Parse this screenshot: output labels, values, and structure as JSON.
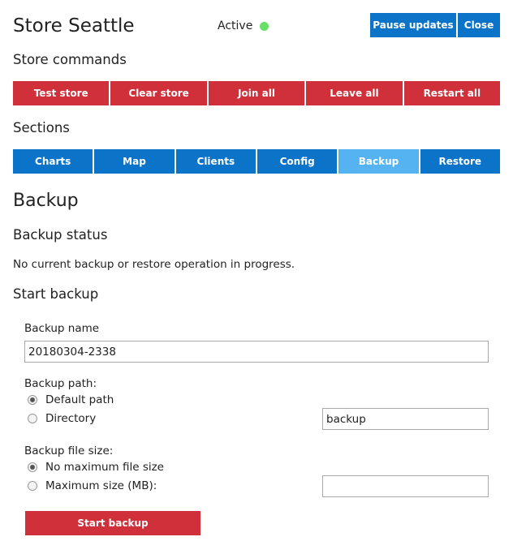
{
  "colors": {
    "blue": "#0b74c8",
    "blue_active": "#56b3f2",
    "red": "#cf303a",
    "status_green": "#66e066"
  },
  "header": {
    "title": "Store Seattle",
    "status": "Active",
    "pause_label": "Pause updates",
    "close_label": "Close"
  },
  "store_commands": {
    "heading": "Store commands",
    "buttons": [
      "Test store",
      "Clear store",
      "Join all",
      "Leave all",
      "Restart all"
    ]
  },
  "sections": {
    "heading": "Sections",
    "tabs": [
      "Charts",
      "Map",
      "Clients",
      "Config",
      "Backup",
      "Restore"
    ],
    "active": "Backup"
  },
  "backup": {
    "title": "Backup",
    "status_heading": "Backup status",
    "status_text": "No current backup or restore operation in progress.",
    "start_heading": "Start backup",
    "name_label": "Backup name",
    "name_value": "20180304-2338",
    "path_label": "Backup path:",
    "path_default": "Default path",
    "path_directory": "Directory",
    "directory_value": "backup",
    "size_label": "Backup file size:",
    "size_none": "No maximum file size",
    "size_max": "Maximum size (MB):",
    "max_size_value": "",
    "start_label": "Start backup"
  }
}
